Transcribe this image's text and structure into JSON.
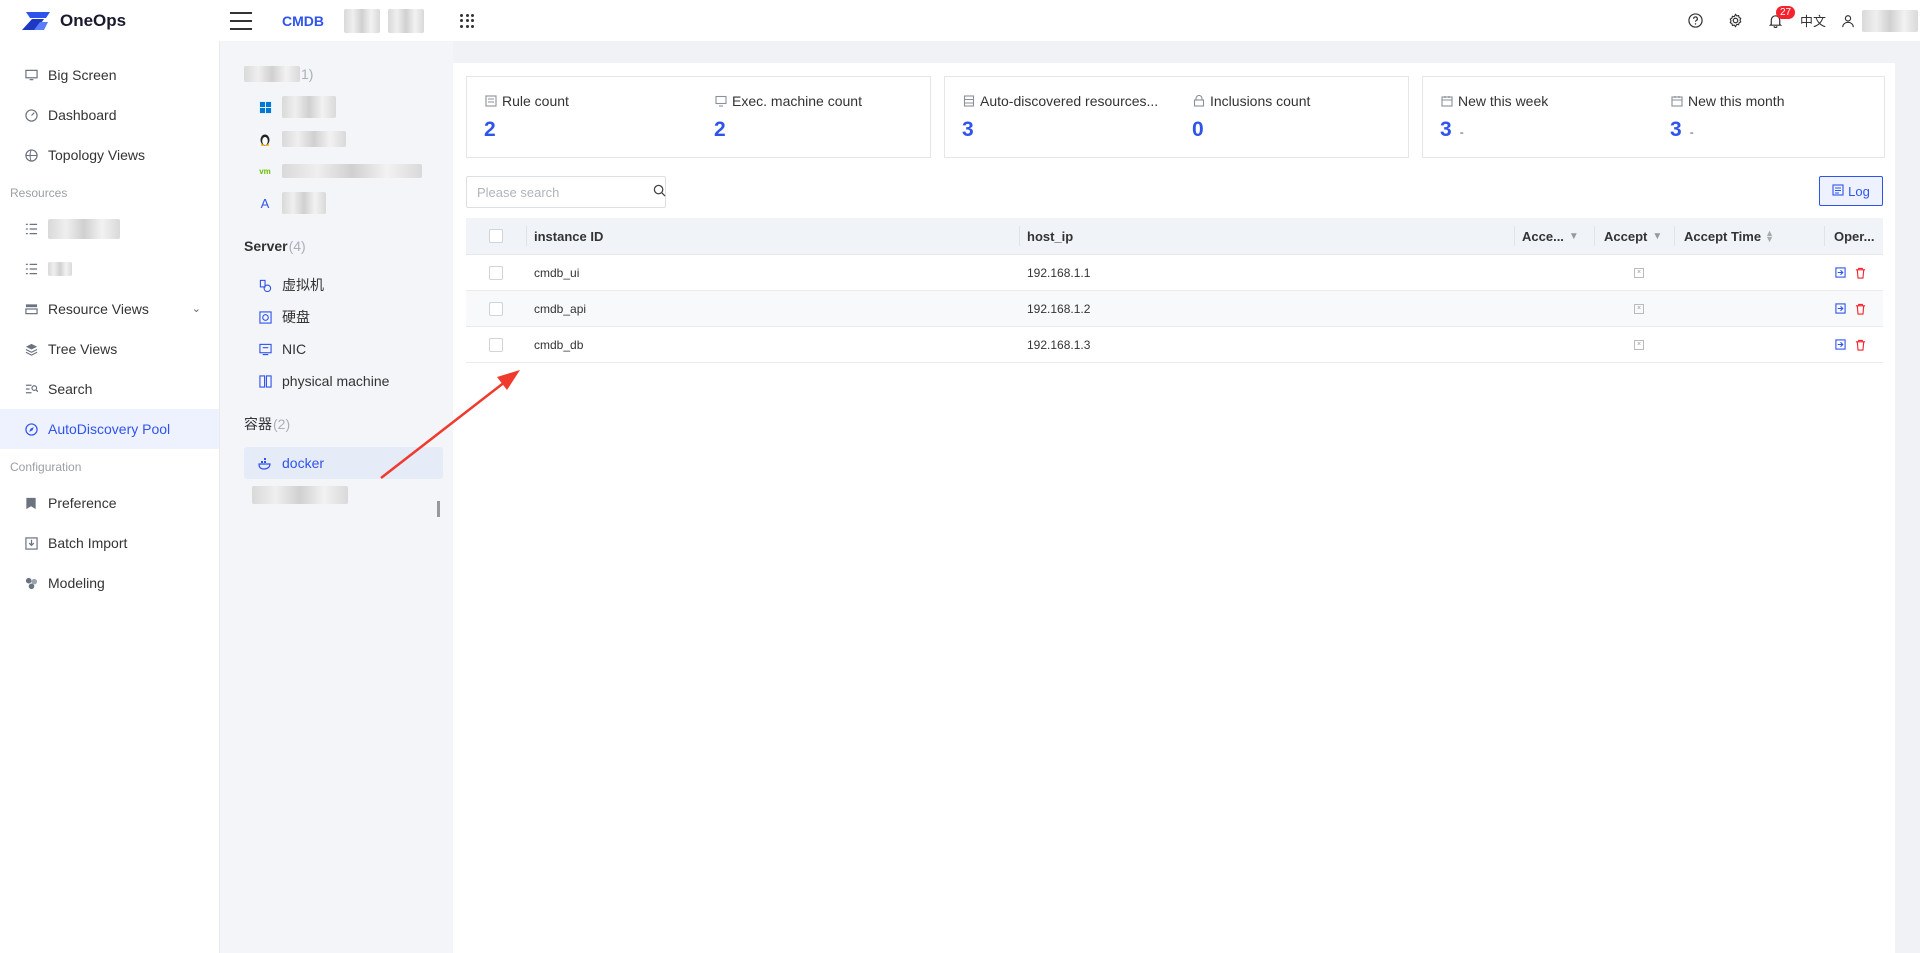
{
  "header": {
    "app_name": "OneOps",
    "module": "CMDB",
    "notification_count": "27",
    "language": "中文"
  },
  "sidebar": {
    "items": [
      {
        "label": "Big Screen",
        "icon": "monitor-icon"
      },
      {
        "label": "Dashboard",
        "icon": "gauge-icon"
      },
      {
        "label": "Topology Views",
        "icon": "topology-icon"
      }
    ],
    "group_resources": "Resources",
    "resource_views": "Resource Views",
    "tree_views": "Tree Views",
    "search": "Search",
    "autodiscovery": "AutoDiscovery Pool",
    "group_configuration": "Configuration",
    "preference": "Preference",
    "batch_import": "Batch Import",
    "modeling": "Modeling"
  },
  "tree": {
    "server_title": "Server",
    "server_count": "(4)",
    "server_items": [
      "虚拟机",
      "硬盘",
      "NIC",
      "physical machine"
    ],
    "container_title": "容器",
    "container_count": "(2)",
    "container_items": [
      "docker"
    ]
  },
  "stats": {
    "rule_count_label": "Rule count",
    "rule_count": "2",
    "exec_count_label": "Exec. machine count",
    "exec_count": "2",
    "auto_label": "Auto-discovered resources...",
    "auto_count": "3",
    "inclusions_label": "Inclusions count",
    "inclusions_count": "0",
    "week_label": "New this week",
    "week_count": "3",
    "week_dash": "-",
    "month_label": "New this month",
    "month_count": "3",
    "month_dash": "-"
  },
  "toolbar": {
    "search_placeholder": "Please search",
    "log_label": "Log"
  },
  "table": {
    "columns": [
      "instance ID",
      "host_ip",
      "Acce...",
      "Accept",
      "Accept Time",
      "Oper..."
    ],
    "rows": [
      {
        "instance_id": "cmdb_ui",
        "host_ip": "192.168.1.1"
      },
      {
        "instance_id": "cmdb_api",
        "host_ip": "192.168.1.2"
      },
      {
        "instance_id": "cmdb_db",
        "host_ip": "192.168.1.3"
      }
    ]
  },
  "colors": {
    "accent": "#2f54eb",
    "danger": "#f5222d",
    "arrow": "#f03a2e"
  }
}
